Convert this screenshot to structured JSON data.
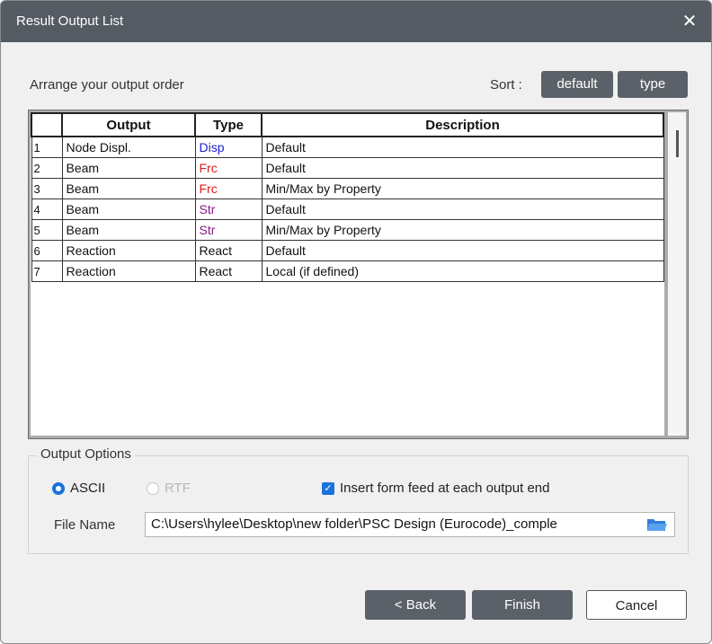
{
  "window": {
    "title": "Result Output List"
  },
  "header": {
    "arrange_label": "Arrange your output order",
    "sort_label": "Sort :"
  },
  "sort_buttons": {
    "default_label": "default",
    "type_label": "type"
  },
  "table": {
    "columns": [
      "",
      "Output",
      "Type",
      "Description"
    ],
    "rows": [
      {
        "num": "1",
        "output": "Node Displ.",
        "type": "Disp",
        "type_color": "#1a1ad6",
        "description": "Default"
      },
      {
        "num": "2",
        "output": "Beam",
        "type": "Frc",
        "type_color": "#e01a1a",
        "description": "Default"
      },
      {
        "num": "3",
        "output": "Beam",
        "type": "Frc",
        "type_color": "#e01a1a",
        "description": "Min/Max by Property"
      },
      {
        "num": "4",
        "output": "Beam",
        "type": "Str",
        "type_color": "#8a1a8a",
        "description": "Default"
      },
      {
        "num": "5",
        "output": "Beam",
        "type": "Str",
        "type_color": "#8a1a8a",
        "description": "Min/Max by Property"
      },
      {
        "num": "6",
        "output": "Reaction",
        "type": "React",
        "type_color": "#111111",
        "description": "Default"
      },
      {
        "num": "7",
        "output": "Reaction",
        "type": "React",
        "type_color": "#111111",
        "description": "Local (if defined)"
      }
    ]
  },
  "options": {
    "legend": "Output Options",
    "ascii_label": "ASCII",
    "rtf_label": "RTF",
    "formfeed_label": "Insert form feed at each output end",
    "filename_label": "File Name",
    "filename_value": "C:\\Users\\hylee\\Desktop\\new folder\\PSC Design (Eurocode)_comple"
  },
  "footer": {
    "back_label": "< Back",
    "finish_label": "Finish",
    "cancel_label": "Cancel"
  },
  "colors": {
    "titlebar": "#555b63",
    "button_dark": "#5b6168",
    "accent": "#1a73d9"
  }
}
